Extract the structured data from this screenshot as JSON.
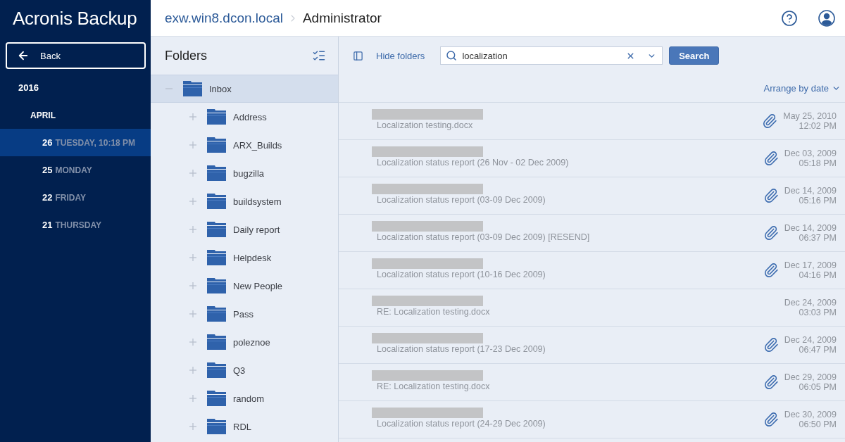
{
  "sidebar": {
    "logo": "Acronis Backup",
    "back_button": "Back",
    "backups": [
      {
        "label": "2016",
        "children": [
          {
            "label": "APRIL",
            "children": [
              {
                "day": "26",
                "label": "TUESDAY, 10:18 PM",
                "selected": true
              },
              {
                "day": "25",
                "label": "MONDAY",
                "selected": false
              },
              {
                "day": "22",
                "label": "FRIDAY",
                "selected": false
              },
              {
                "day": "21",
                "label": "THURSDAY",
                "selected": false
              }
            ]
          }
        ]
      }
    ]
  },
  "header": {
    "breadcrumb": [
      "exw.win8.dcon.local",
      "Administrator"
    ]
  },
  "folders": {
    "title": "Folders",
    "items": [
      {
        "label": "Inbox",
        "expanded": true,
        "selected": true,
        "children": [
          {
            "label": "Address",
            "expanded": false,
            "selected": false
          },
          {
            "label": "ARX_Builds",
            "expanded": false,
            "selected": false
          },
          {
            "label": "bugzilla",
            "expanded": false,
            "selected": false
          },
          {
            "label": "buildsystem",
            "expanded": false,
            "selected": false
          },
          {
            "label": "Daily report",
            "expanded": false,
            "selected": false
          },
          {
            "label": "Helpdesk",
            "expanded": false,
            "selected": false
          },
          {
            "label": "New People",
            "expanded": false,
            "selected": false
          },
          {
            "label": "Pass",
            "expanded": false,
            "selected": false
          },
          {
            "label": "poleznoe",
            "expanded": false,
            "selected": false
          },
          {
            "label": "Q3",
            "expanded": false,
            "selected": false
          },
          {
            "label": "random",
            "expanded": false,
            "selected": false
          },
          {
            "label": "RDL",
            "expanded": false,
            "selected": false
          }
        ]
      }
    ]
  },
  "toolbar": {
    "hide_folders": "Hide folders",
    "search": {
      "value": "localization"
    },
    "search_button": "Search"
  },
  "sort": {
    "label": "Arrange by date"
  },
  "messages": [
    {
      "sender_hidden": true,
      "subject": "Localization testing.docx",
      "date": "May 25, 2010",
      "time": "12:02 PM",
      "attachment": true
    },
    {
      "sender_hidden": true,
      "subject": "Localization status report (26 Nov - 02 Dec 2009)",
      "date": "Dec 03, 2009",
      "time": "05:18 PM",
      "attachment": true
    },
    {
      "sender_hidden": true,
      "subject": "Localization status report (03-09 Dec 2009)",
      "date": "Dec 14, 2009",
      "time": "05:16 PM",
      "attachment": true
    },
    {
      "sender_hidden": true,
      "subject": "Localization status report (03-09 Dec 2009) [RESEND]",
      "date": "Dec 14, 2009",
      "time": "06:37 PM",
      "attachment": true
    },
    {
      "sender_hidden": true,
      "subject": "Localization status report (10-16 Dec 2009)",
      "date": "Dec 17, 2009",
      "time": "04:16 PM",
      "attachment": true
    },
    {
      "sender_hidden": true,
      "subject": "RE: Localization testing.docx",
      "date": "Dec 24, 2009",
      "time": "03:03 PM",
      "attachment": false
    },
    {
      "sender_hidden": true,
      "subject": "Localization status report (17-23 Dec 2009)",
      "date": "Dec 24, 2009",
      "time": "06:47 PM",
      "attachment": true
    },
    {
      "sender_hidden": true,
      "subject": "RE: Localization testing.docx",
      "date": "Dec 29, 2009",
      "time": "06:05 PM",
      "attachment": true
    },
    {
      "sender_hidden": true,
      "subject": "Localization status report (24-29 Dec 2009)",
      "date": "Dec 30, 2009",
      "time": "06:50 PM",
      "attachment": true
    }
  ]
}
